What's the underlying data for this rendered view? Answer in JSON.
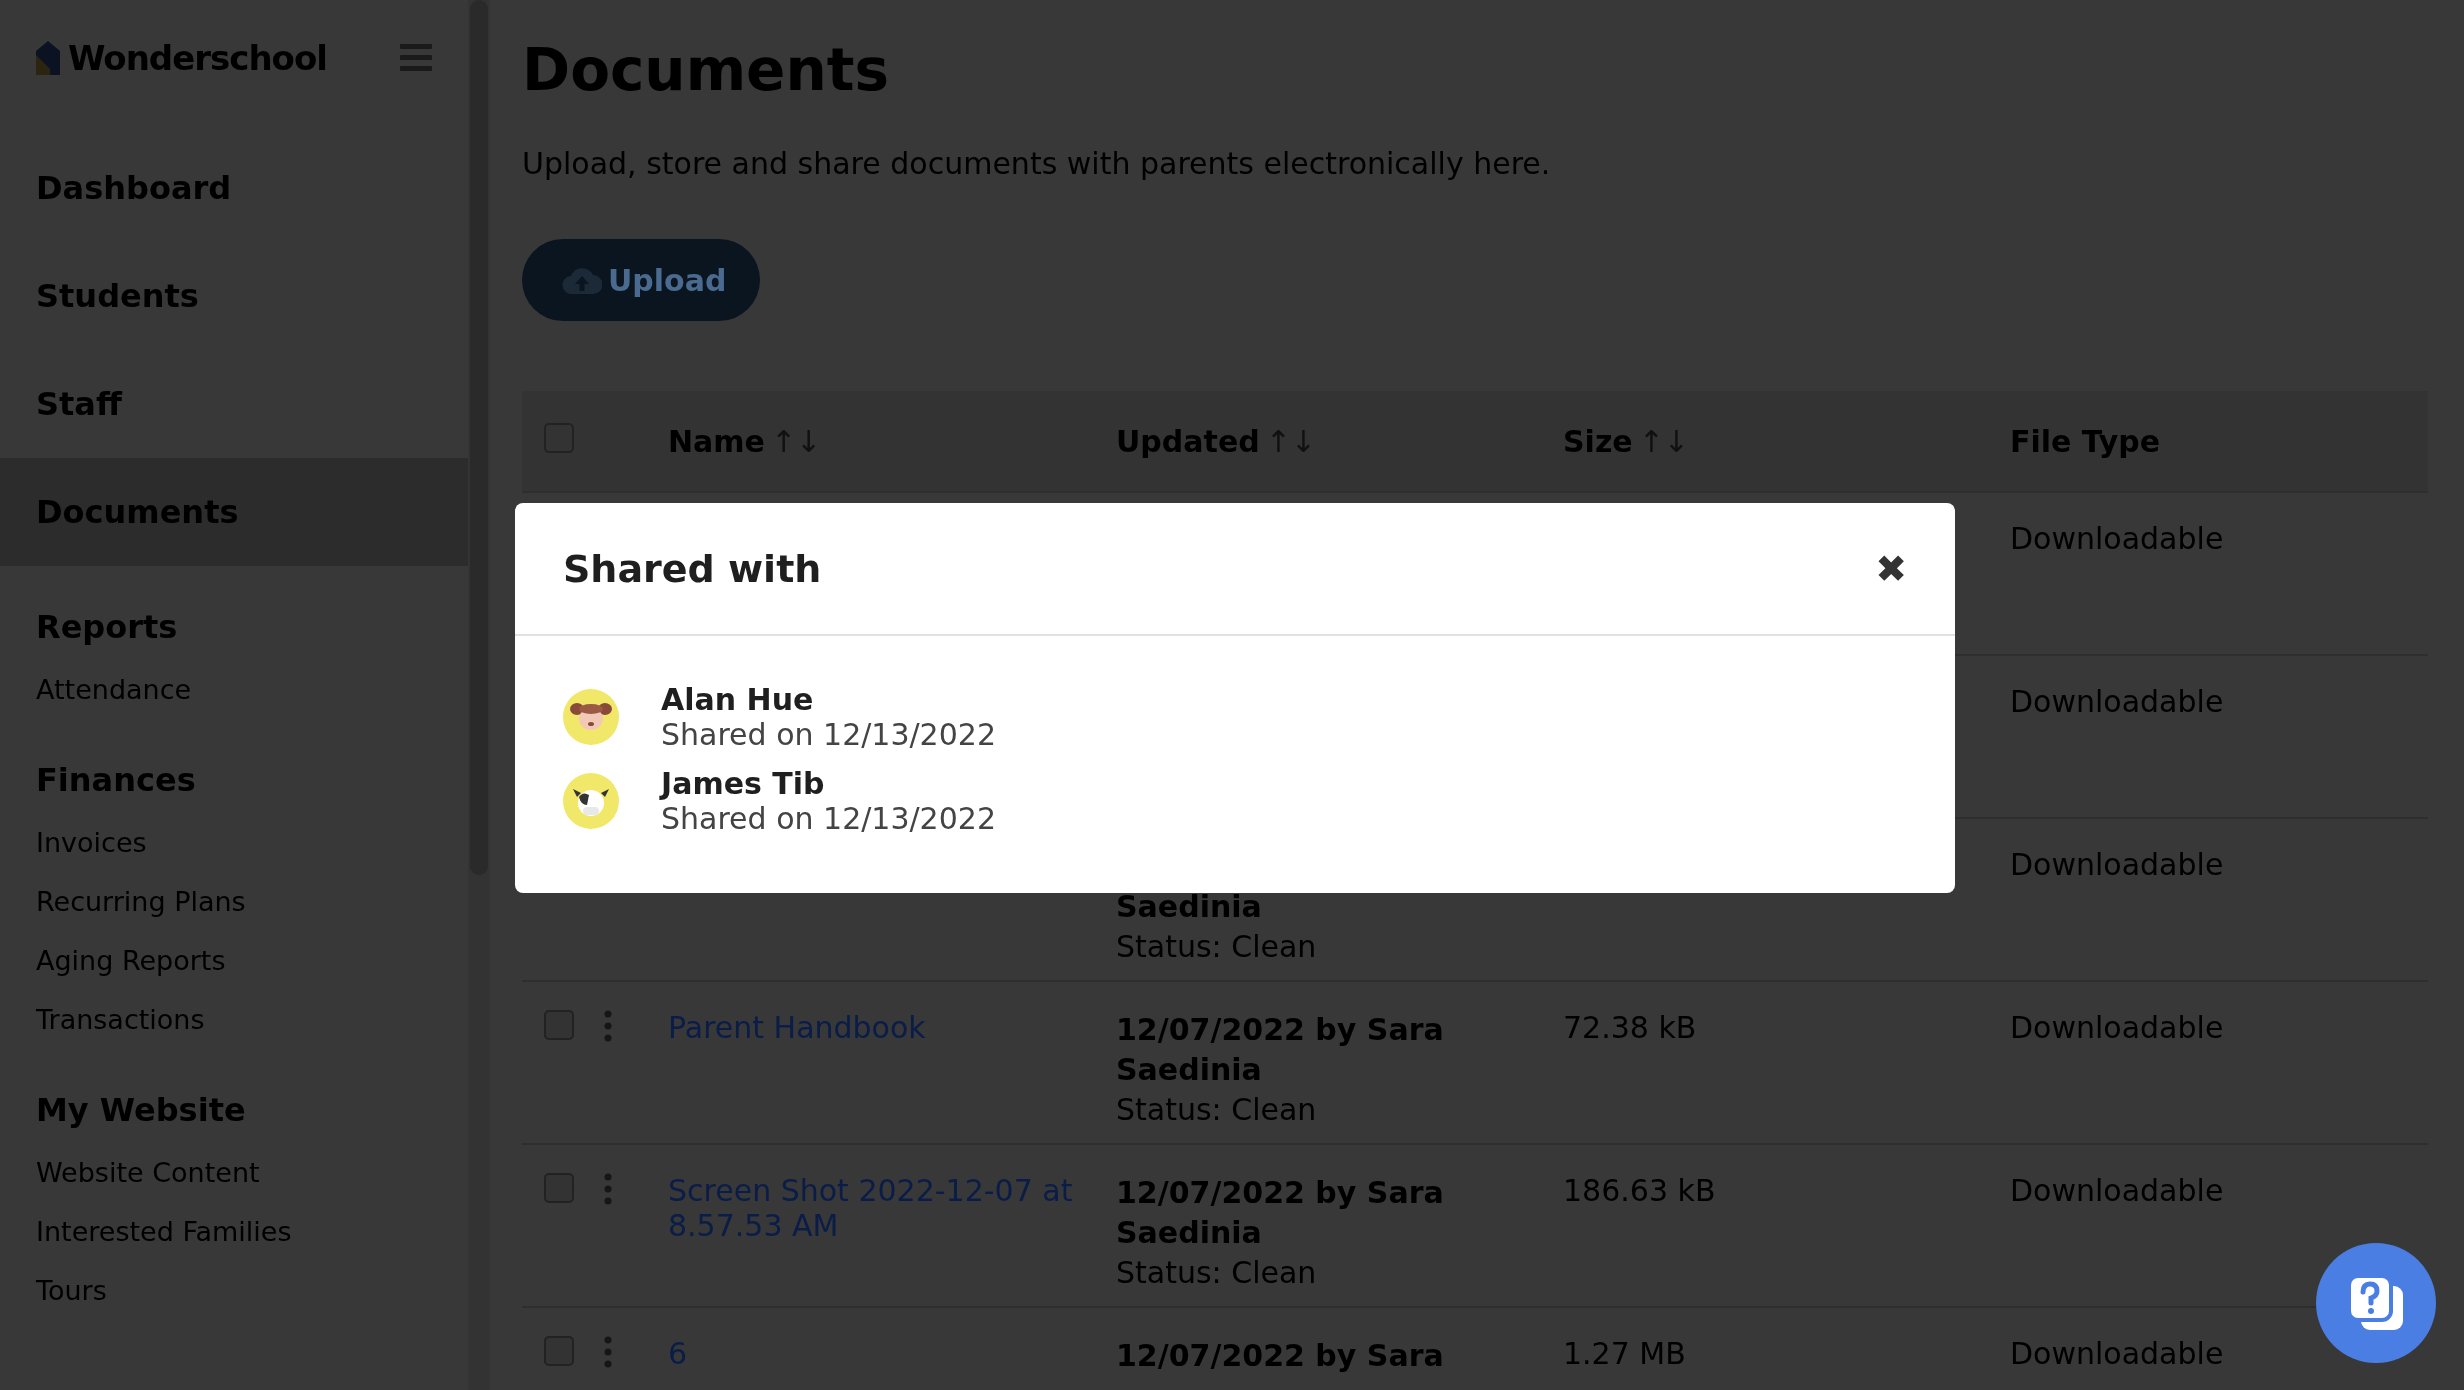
{
  "sidebar": {
    "logo": "Wonderschool",
    "items": [
      {
        "label": "Dashboard",
        "kind": "heading",
        "selected": false
      },
      {
        "label": "Students",
        "kind": "heading",
        "selected": false
      },
      {
        "label": "Staff",
        "kind": "heading",
        "selected": false
      },
      {
        "label": "Documents",
        "kind": "heading",
        "selected": true
      },
      {
        "label": "Reports",
        "kind": "section"
      },
      {
        "label": "Attendance",
        "kind": "link"
      },
      {
        "label": "Finances",
        "kind": "section"
      },
      {
        "label": "Invoices",
        "kind": "link"
      },
      {
        "label": "Recurring Plans",
        "kind": "link"
      },
      {
        "label": "Aging Reports",
        "kind": "link"
      },
      {
        "label": "Transactions",
        "kind": "link"
      },
      {
        "label": "My Website",
        "kind": "section"
      },
      {
        "label": "Website Content",
        "kind": "link"
      },
      {
        "label": "Interested Families",
        "kind": "link"
      },
      {
        "label": "Tours",
        "kind": "link"
      }
    ]
  },
  "page": {
    "title": "Documents",
    "subtitle": "Upload, store and share documents with parents electronically here.",
    "upload_button": "Upload"
  },
  "table": {
    "select_all": {
      "checked": false
    },
    "columns": [
      {
        "label": "Name",
        "sort": "↑↓"
      },
      {
        "label": "Updated",
        "sort": "↑↓"
      },
      {
        "label": "Size",
        "sort": "↑↓"
      },
      {
        "label": "File Type"
      }
    ],
    "rows": [
      {
        "kind": "covered",
        "file_type": "Downloadable"
      },
      {
        "kind": "covered",
        "file_type": "Downloadable"
      },
      {
        "kind": "covered",
        "updated_lines": [
          "Saedinia"
        ],
        "status": "Status: Clean",
        "file_type": "Downloadable"
      },
      {
        "kind": "full",
        "checked": false,
        "name": "Parent Handbook",
        "updated_lines": [
          "12/07/2022 by Sara",
          "Saedinia"
        ],
        "status": "Status: Clean",
        "size": "72.38 kB",
        "file_type": "Downloadable"
      },
      {
        "kind": "full",
        "checked": false,
        "name": "Screen Shot 2022-12-07 at 8.57.53 AM",
        "updated_lines": [
          "12/07/2022 by Sara",
          "Saedinia"
        ],
        "status": "Status: Clean",
        "size": "186.63 kB",
        "file_type": "Downloadable"
      },
      {
        "kind": "full",
        "checked": false,
        "name": "6",
        "updated_lines": [
          "12/07/2022 by Sara"
        ],
        "size": "1.27 MB",
        "file_type": "Downloadable"
      }
    ]
  },
  "modal": {
    "title": "Shared with",
    "close": "✖",
    "people": [
      {
        "name": "Alan Hue",
        "shared": "Shared on 12/13/2022",
        "kind": "dog"
      },
      {
        "name": "James Tib",
        "shared": "Shared on 12/13/2022",
        "kind": "cow"
      }
    ]
  }
}
